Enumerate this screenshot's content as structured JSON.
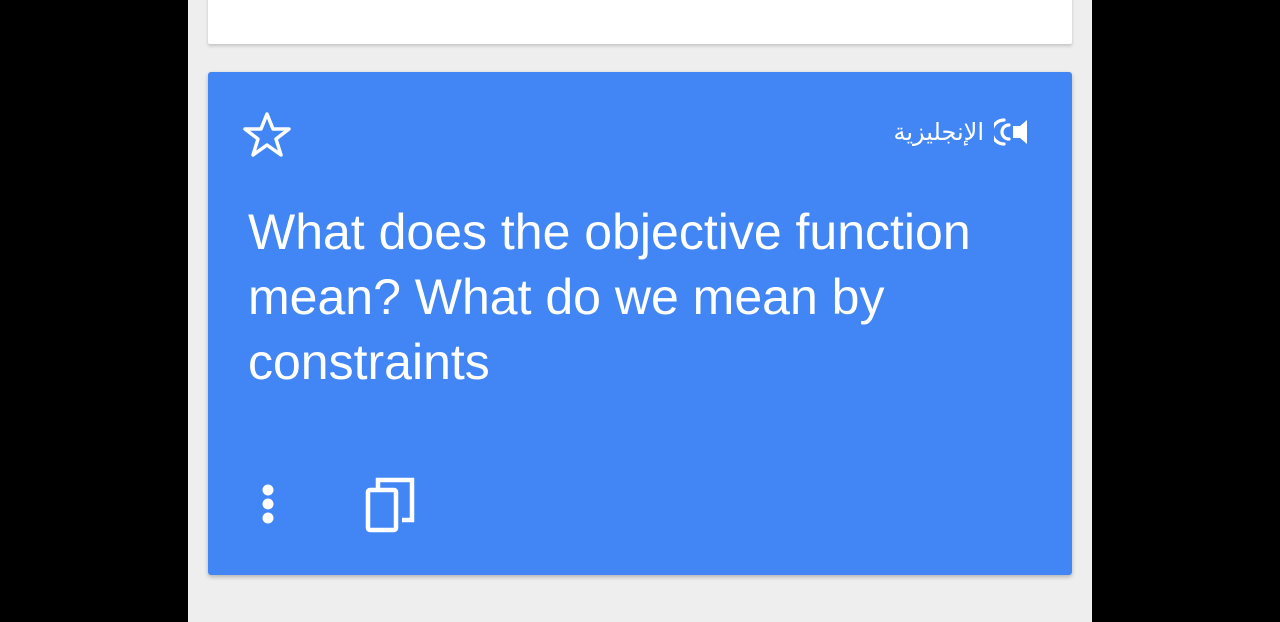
{
  "translation_card": {
    "language_label": "الإنجليزية",
    "text": "What does the objective function mean?  What do we mean by constraints"
  },
  "colors": {
    "card": "#4285f4",
    "background": "#eeeeee",
    "bezel": "#000000"
  },
  "icons": {
    "favorite": "star-outline-icon",
    "listen": "speaker-icon",
    "menu": "more-vert-icon",
    "copy": "copy-icon"
  }
}
